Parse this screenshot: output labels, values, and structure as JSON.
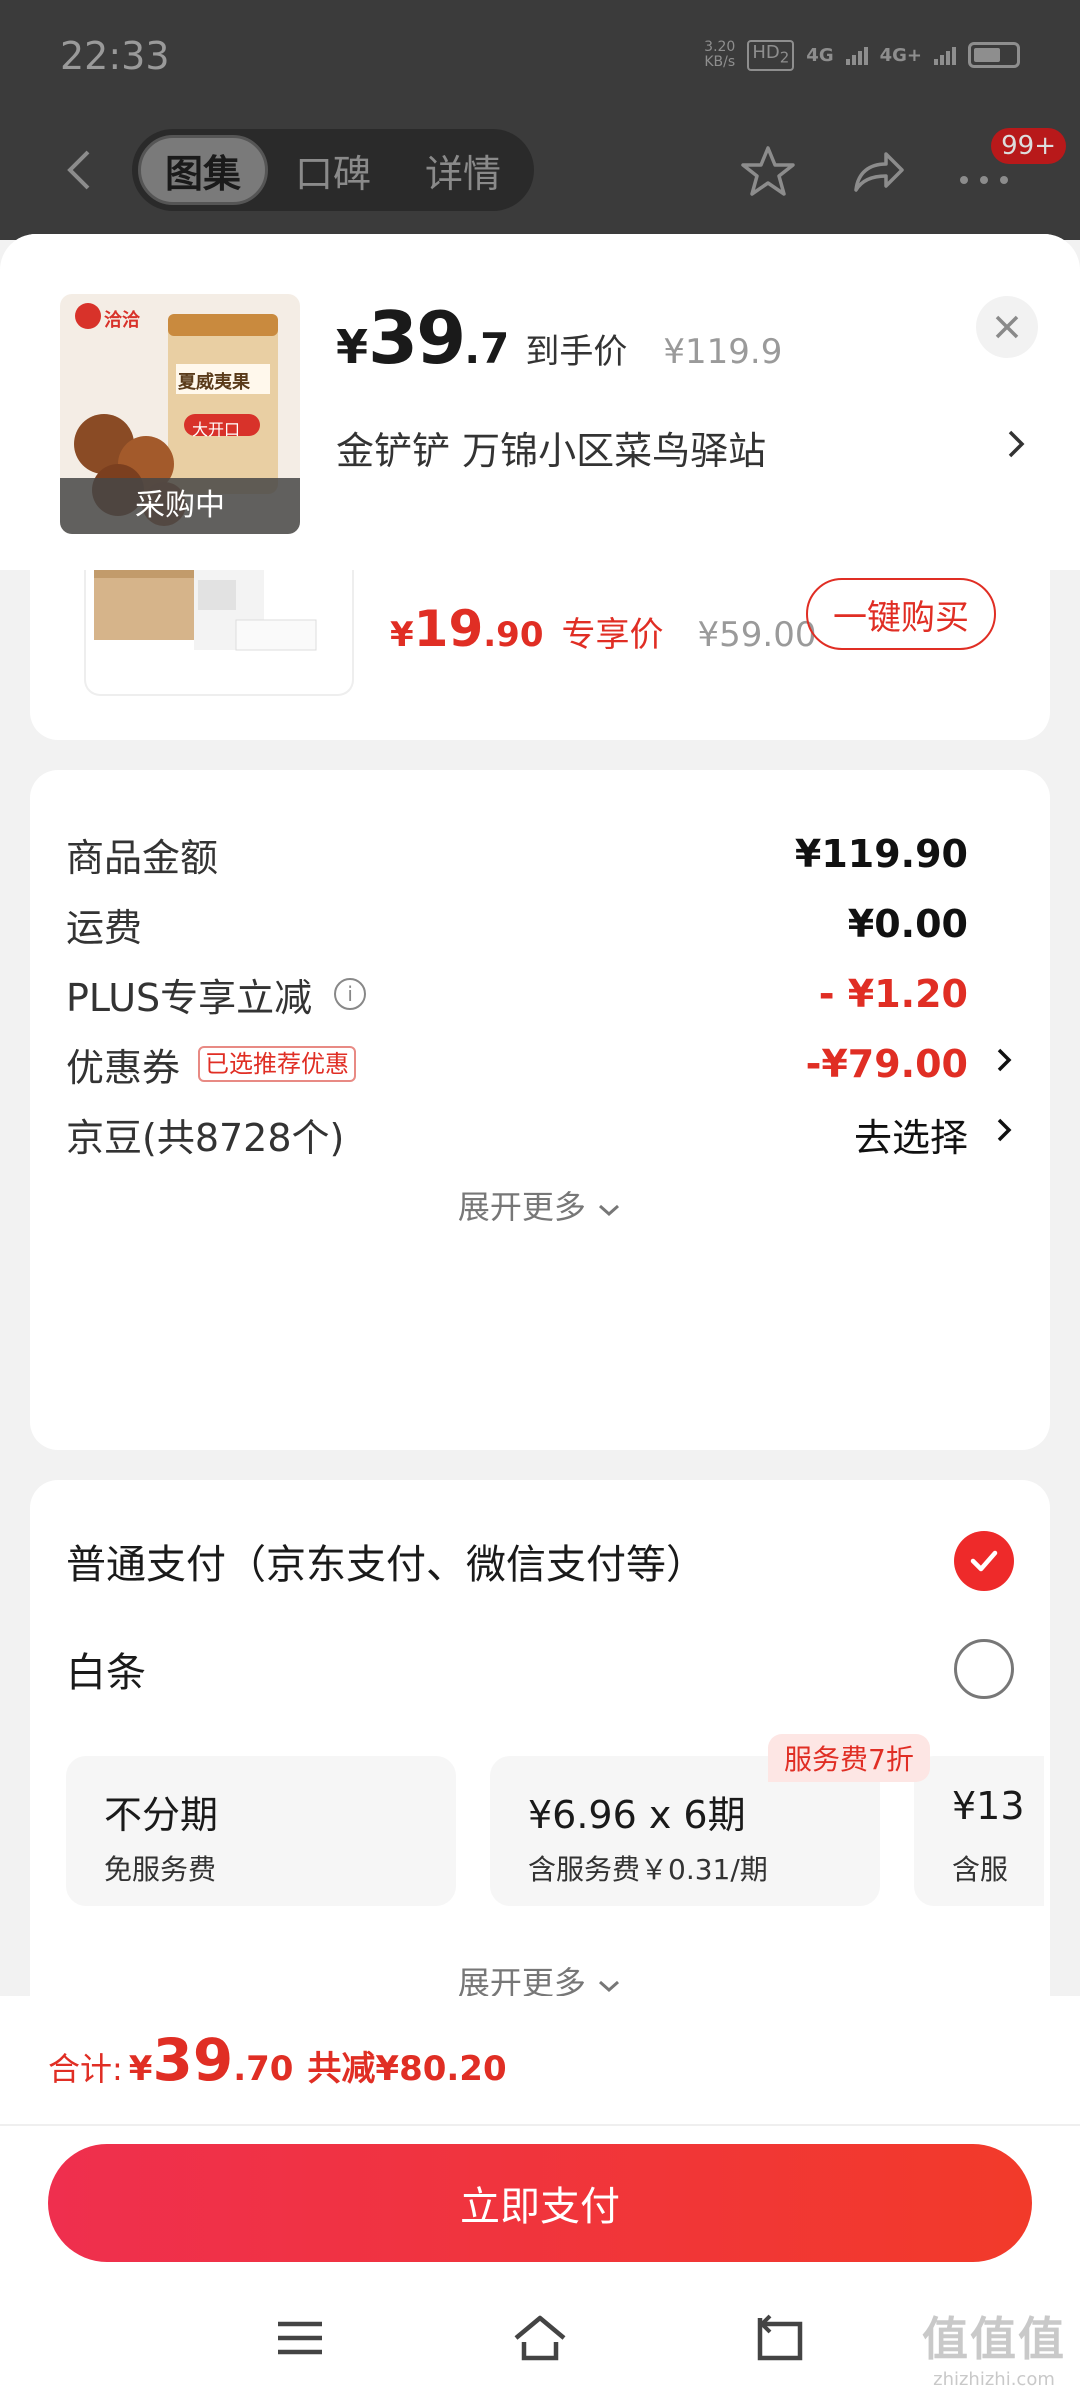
{
  "status_bar": {
    "time": "22:33",
    "net_speed_value": "3.20",
    "net_speed_unit": "KB/s",
    "hd_label": "HD",
    "hd_sub": "2",
    "sig1": "4G",
    "sig2": "4G+"
  },
  "top_nav": {
    "tabs": [
      {
        "label": "图集",
        "active": true
      },
      {
        "label": "口碑",
        "active": false
      },
      {
        "label": "详情",
        "active": false
      }
    ],
    "badge": "99+"
  },
  "summary": {
    "thumb_caption": "采购中",
    "thumb_brand": "洽洽",
    "thumb_product": "夏威夷果",
    "thumb_tag": "大开口",
    "price_symbol": "¥",
    "price_int": "39",
    "price_dec": ".7",
    "price_label": "到手价",
    "original_price": "¥119.9",
    "address": "金铲铲  万锦小区菜鸟驿站"
  },
  "upsell": {
    "price_symbol": "¥",
    "price_int": "19",
    "price_dec": ".90",
    "price_label": "专享价",
    "original_price": "¥59.00",
    "buy_label": "一键购买"
  },
  "fees": {
    "rows": [
      {
        "label": "商品金额",
        "value": "¥119.90"
      },
      {
        "label": "运费",
        "value": "¥0.00"
      },
      {
        "label": "PLUS专享立减",
        "value": "- ¥1.20"
      },
      {
        "label": "优惠券",
        "tag": "已选推荐优惠",
        "value": "-¥79.00"
      },
      {
        "label": "京豆(共8728个)",
        "value": "去选择"
      }
    ],
    "expand_label": "展开更多"
  },
  "payment": {
    "methods": [
      {
        "label": "普通支付（京东支付、微信支付等）",
        "selected": true
      },
      {
        "label": "白条",
        "selected": false
      }
    ],
    "discount_tag": "服务费7折",
    "installments": [
      {
        "main": "不分期",
        "sub": "免服务费"
      },
      {
        "main": "¥6.96 x 6期",
        "sub": "含服务费￥0.31/期"
      },
      {
        "main": "¥13",
        "sub": "含服"
      }
    ],
    "expand_label": "展开更多"
  },
  "bottom": {
    "total_label": "合计:",
    "total_symbol": "¥",
    "total_int": "39",
    "total_dec": ".70",
    "saved": "共减¥80.20",
    "pay_button": "立即支付"
  },
  "watermark": {
    "main": "值值值",
    "sub": "zhizhizhi.com"
  },
  "colors": {
    "accent_red": "#e02e24",
    "pay_gradient_start": "#ef2f4e",
    "pay_gradient_end": "#f23a2a"
  },
  "icons": [
    "back-arrow-icon",
    "star-icon",
    "share-icon",
    "more-icon",
    "close-icon",
    "chevron-right-icon",
    "info-icon",
    "chevron-down-icon",
    "check-icon",
    "menu-icon",
    "home-icon",
    "return-icon"
  ]
}
